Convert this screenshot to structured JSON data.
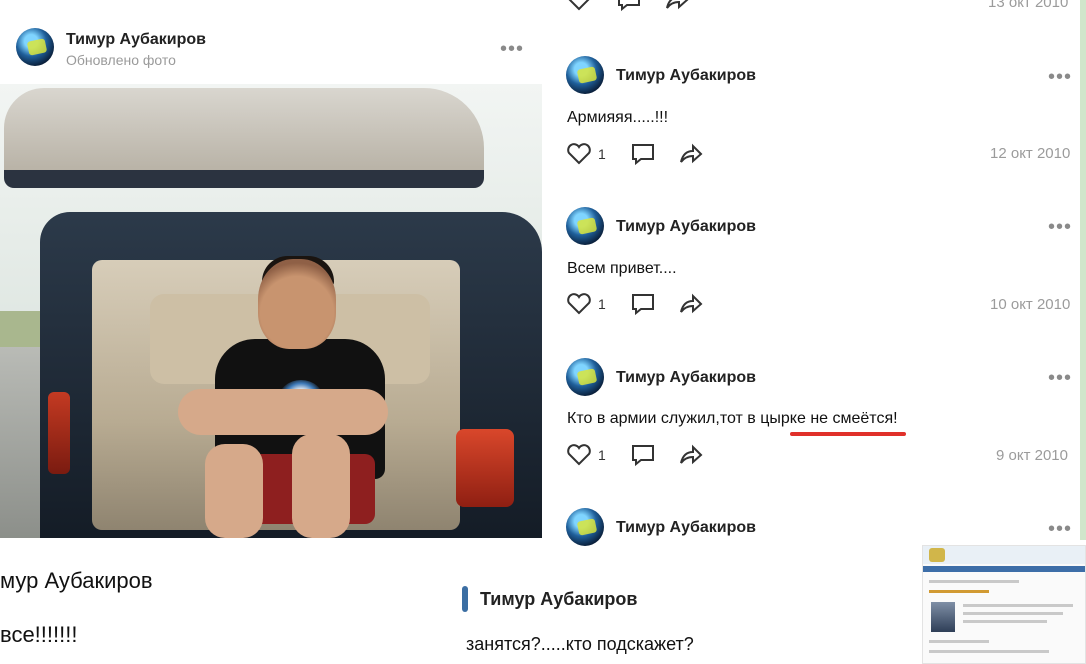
{
  "left_post": {
    "author": "Тимур Аубакиров",
    "subtitle": "Обновлено фото",
    "more": "•••"
  },
  "top_partial": {
    "date": "13 окт 2010"
  },
  "posts": [
    {
      "author": "Тимур Аубакиров",
      "text": "Армияяя.....!!!",
      "likes": "1",
      "date": "12 окт 2010"
    },
    {
      "author": "Тимур Аубакиров",
      "text": "Всем привет....",
      "likes": "1",
      "date": "10 окт 2010"
    },
    {
      "author": "Тимур Аубакиров",
      "text": "Кто в армии служил,тот в цырке не смеётся!",
      "likes": "1",
      "date": "9 окт 2010"
    },
    {
      "author": "Тимур Аубакиров"
    }
  ],
  "bottom": {
    "left_name": "мур Аубакиров",
    "left_text": "все!!!!!!!",
    "mid_name": "Тимур Аубакиров",
    "mid_text": "занятся?.....кто подскажет?"
  },
  "more_label": "•••",
  "colors": {
    "underline": "#e0302a",
    "date": "#9b9b9b"
  }
}
